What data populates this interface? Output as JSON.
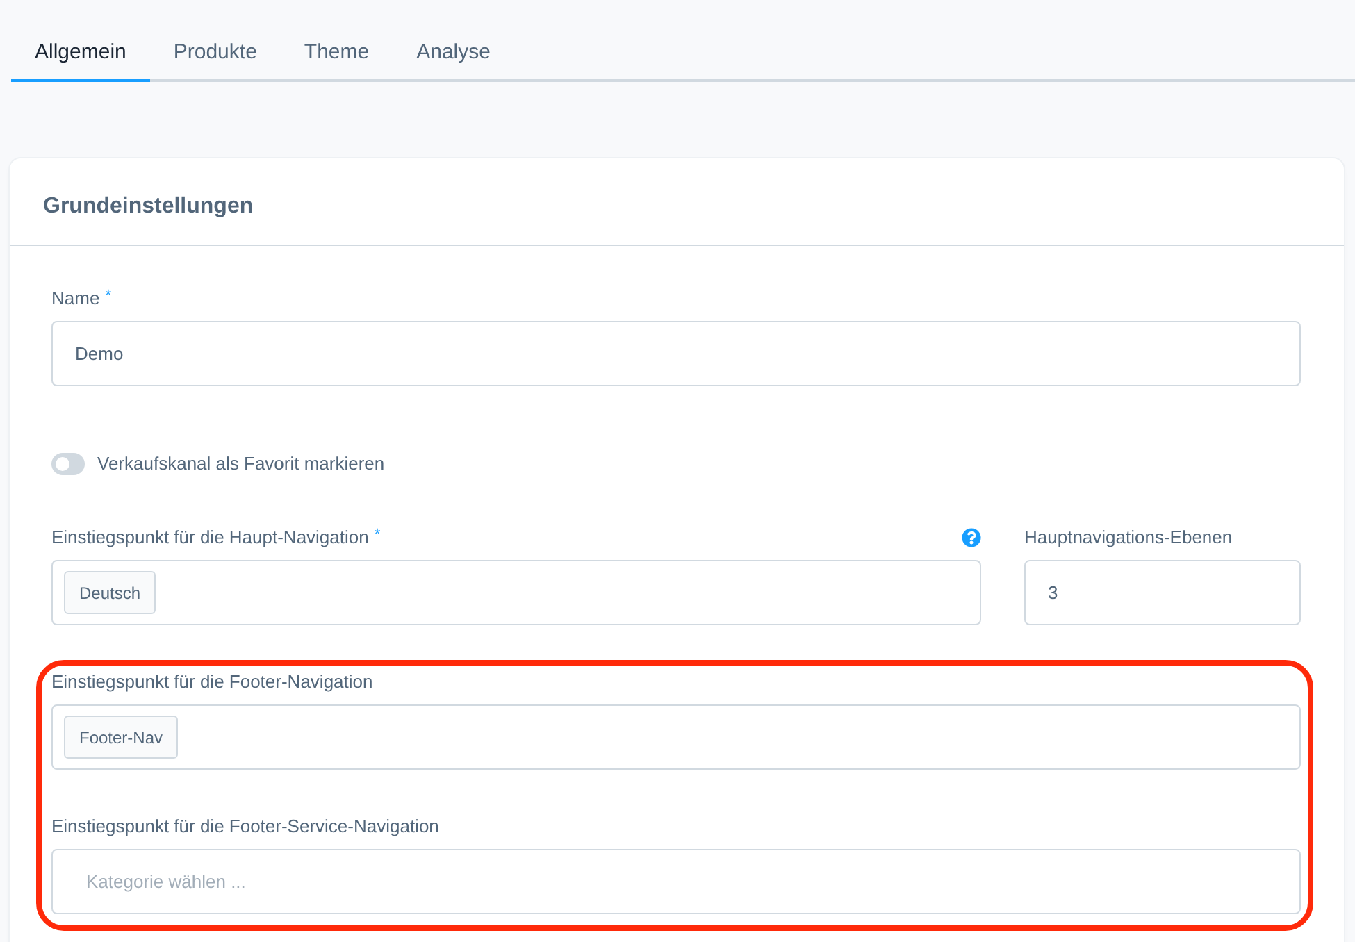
{
  "tabs": [
    {
      "label": "Allgemein",
      "selected": true
    },
    {
      "label": "Produkte",
      "selected": false
    },
    {
      "label": "Theme",
      "selected": false
    },
    {
      "label": "Analyse",
      "selected": false
    }
  ],
  "card": {
    "title": "Grundeinstellungen",
    "name_field": {
      "label": "Name",
      "required_mark": "*",
      "kind": "text",
      "value": "Demo"
    },
    "favorite_toggle": {
      "label": "Verkaufskanal als Favorit markieren",
      "on": false
    },
    "navigation_row": [
      {
        "label": "Einstiegspunkt für die Haupt-Navigation",
        "required_mark": "*",
        "help": true,
        "kind": "tags",
        "tags": [
          "Deutsch"
        ]
      },
      {
        "label": "Hauptnavigations-Ebenen",
        "kind": "text",
        "value": "3"
      }
    ],
    "footer_group": {
      "highlighted": true,
      "fields": [
        {
          "label": "Einstiegspunkt für die Footer-Navigation",
          "kind": "tags",
          "tags": [
            "Footer-Nav"
          ]
        },
        {
          "label": "Einstiegspunkt für die Footer-Service-Navigation",
          "kind": "tags",
          "placeholder": "Kategorie wählen ..."
        }
      ]
    }
  }
}
